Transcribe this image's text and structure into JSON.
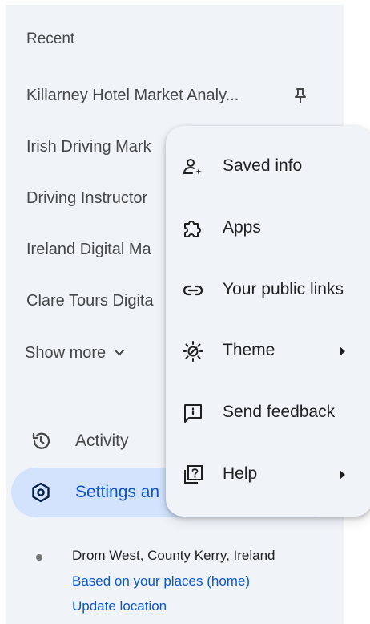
{
  "sidebar": {
    "recent_heading": "Recent",
    "recent_items": [
      {
        "label": "Killarney Hotel Market Analy...",
        "pinned": true
      },
      {
        "label": "Irish Driving Mark"
      },
      {
        "label": "Driving Instructor"
      },
      {
        "label": "Ireland Digital Ma"
      },
      {
        "label": "Clare Tours Digita"
      }
    ],
    "show_more": "Show more",
    "nav": {
      "activity": "Activity",
      "settings": "Settings an"
    },
    "location": {
      "place": "Drom West, County Kerry, Ireland",
      "source_link": "Based on your places (home)",
      "update_link": "Update location"
    }
  },
  "menu": {
    "items": [
      {
        "label": "Saved info",
        "icon": "person-sparkle-icon",
        "submenu": false
      },
      {
        "label": "Apps",
        "icon": "puzzle-icon",
        "submenu": false
      },
      {
        "label": "Your public links",
        "icon": "link-icon",
        "submenu": false
      },
      {
        "label": "Theme",
        "icon": "theme-icon",
        "submenu": true
      },
      {
        "label": "Send feedback",
        "icon": "feedback-icon",
        "submenu": false
      },
      {
        "label": "Help",
        "icon": "help-icon",
        "submenu": true
      }
    ]
  },
  "colors": {
    "sidebar_bg": "#f0f4f9",
    "selected_bg": "#d3e3fd",
    "link": "#0b57d0",
    "text": "#1f1f1f",
    "muted": "#444746"
  }
}
